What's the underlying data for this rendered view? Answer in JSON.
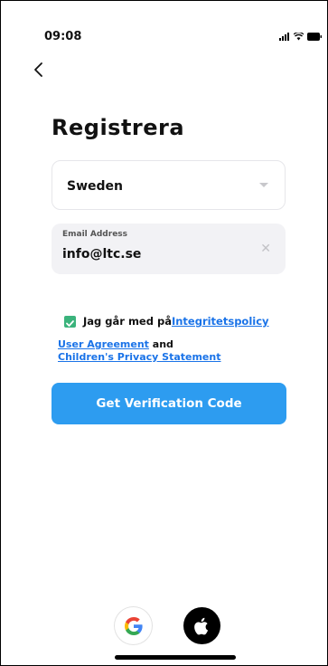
{
  "status_bar": {
    "time": "09:08"
  },
  "header": {
    "title": "Registrera"
  },
  "form": {
    "country_value": "Sweden",
    "email_label": "Email Address",
    "email_value": "info@ltc.se",
    "agreement": {
      "checked": true,
      "prefix": "Jag går med på",
      "privacy_link": "Integritetspolicy",
      "user_agreement_link": "User Agreement",
      "and_text": " and",
      "children_link": "Children's Privacy Statement"
    },
    "submit_label": "Get Verification Code"
  },
  "social_login": {
    "google_icon": "google-icon",
    "apple_icon": "apple-icon"
  },
  "colors": {
    "primary": "#2d9cf0",
    "link": "#1a73e8",
    "checkbox": "#3bb37c"
  }
}
